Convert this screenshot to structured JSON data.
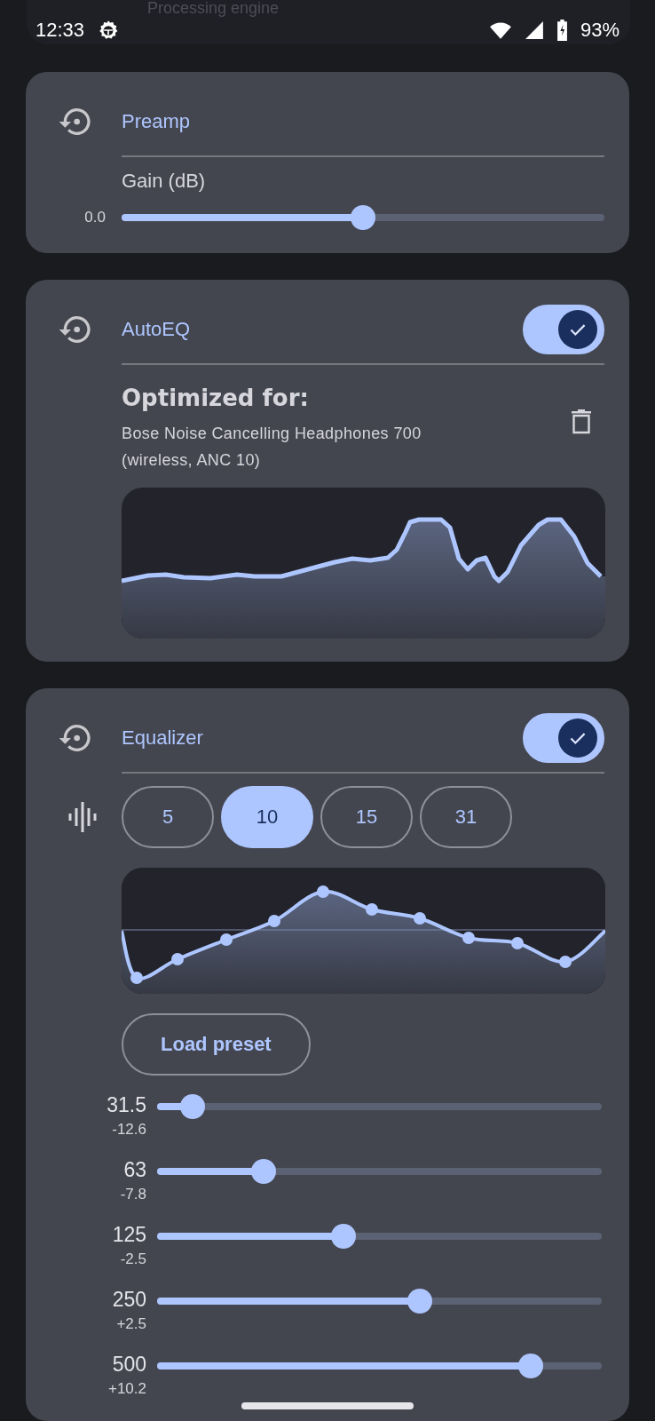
{
  "behind_status_bar": {
    "title": "Processing engine"
  },
  "status_bar": {
    "time": "12:33",
    "battery": "93%"
  },
  "preamp": {
    "title": "Preamp",
    "label": "Gain (dB)",
    "value": "0.0",
    "level": 0.5
  },
  "autoeq": {
    "title": "AutoEQ",
    "on": true,
    "heading": "Optimized for:",
    "device": "Bose Noise Cancelling Headphones 700 (wireless, ANC 10)"
  },
  "equalizer": {
    "title": "Equalizer",
    "on": true,
    "band_counts": [
      {
        "label": "5",
        "selected": false
      },
      {
        "label": "10",
        "selected": true
      },
      {
        "label": "15",
        "selected": false
      },
      {
        "label": "31",
        "selected": false
      }
    ],
    "load_preset": "Load preset",
    "bands": [
      {
        "freq": "31.5",
        "gain": "-12.6",
        "level": 0.08
      },
      {
        "freq": "63",
        "gain": "-7.8",
        "level": 0.24
      },
      {
        "freq": "125",
        "gain": "-2.5",
        "level": 0.42
      },
      {
        "freq": "250",
        "gain": "+2.5",
        "level": 0.59
      },
      {
        "freq": "500",
        "gain": "+10.2",
        "level": 0.84
      }
    ]
  }
}
